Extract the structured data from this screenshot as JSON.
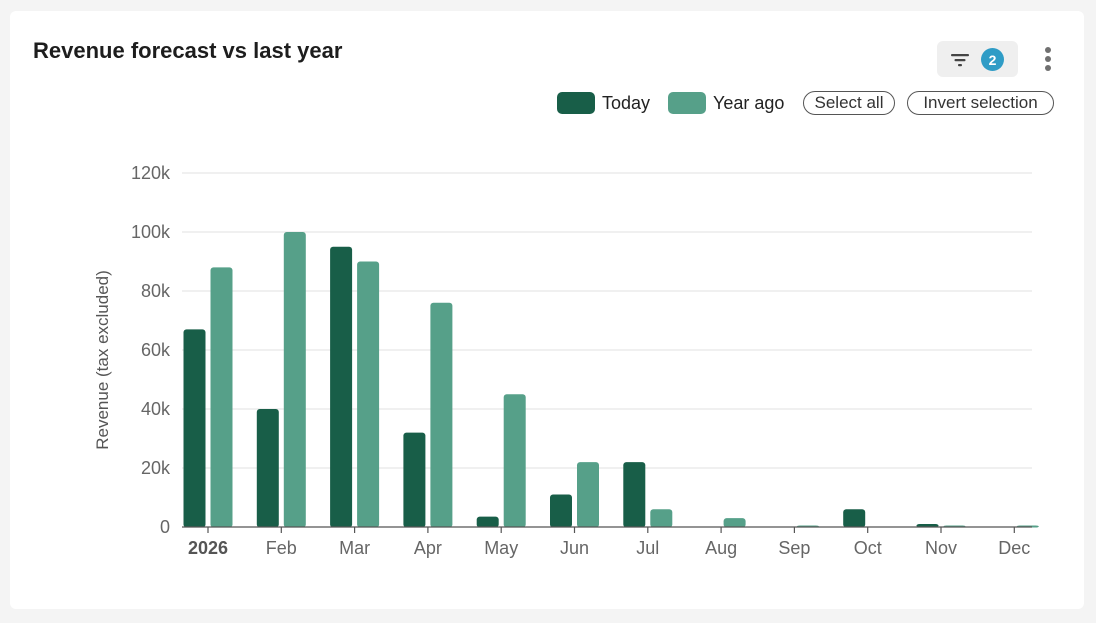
{
  "header": {
    "title": "Revenue forecast vs last year",
    "filter_count": "2"
  },
  "legend": {
    "items": [
      {
        "label": "Today",
        "color": "#185e48"
      },
      {
        "label": "Year ago",
        "color": "#56a089"
      }
    ],
    "select_all": "Select all",
    "invert_selection": "Invert selection"
  },
  "icons": {
    "filter": "filter-icon",
    "more": "more-vertical-icon"
  },
  "chart_data": {
    "type": "bar",
    "categories": [
      "2026",
      "Feb",
      "Mar",
      "Apr",
      "May",
      "Jun",
      "Jul",
      "Aug",
      "Sep",
      "Oct",
      "Nov",
      "Dec"
    ],
    "bold_categories": [
      "2026"
    ],
    "series": [
      {
        "name": "Today",
        "color": "#185e48",
        "values": [
          67000,
          40000,
          95000,
          32000,
          3500,
          11000,
          22000,
          0,
          0,
          6000,
          1000,
          0
        ]
      },
      {
        "name": "Year ago",
        "color": "#56a089",
        "values": [
          88000,
          100000,
          90000,
          76000,
          45000,
          22000,
          6000,
          3000,
          200,
          0,
          400,
          300
        ]
      }
    ],
    "ylabel": "Revenue (tax excluded)",
    "xlabel": "",
    "ylim": [
      0,
      120000
    ],
    "yticks": [
      0,
      20000,
      40000,
      60000,
      80000,
      100000,
      120000
    ],
    "ytick_labels": [
      "0",
      "20k",
      "40k",
      "60k",
      "80k",
      "100k",
      "120k"
    ],
    "grid": true,
    "legend_position": "top-right"
  }
}
